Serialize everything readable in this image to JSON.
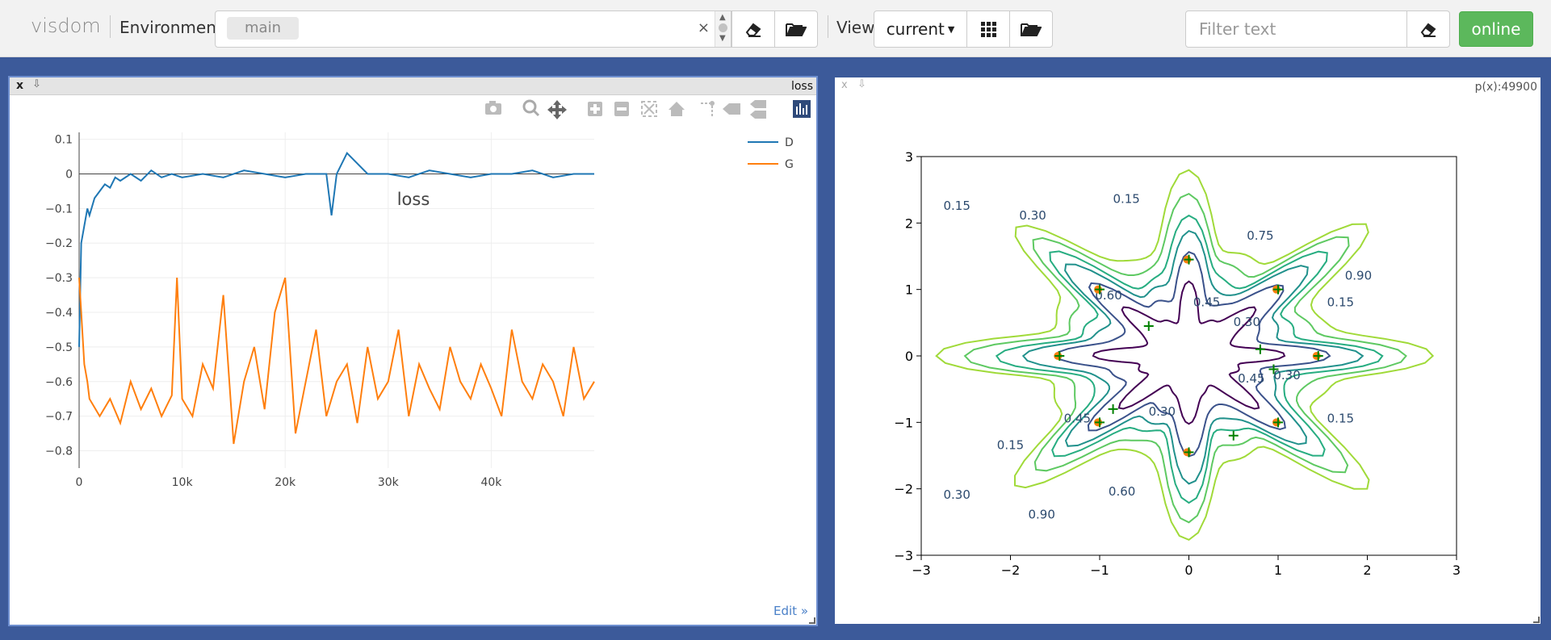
{
  "topbar": {
    "logo": "visdom",
    "environment_label": "Environment",
    "env_chip": "main",
    "env_clear": "×",
    "view_label": "View",
    "view_value": "current",
    "filter_placeholder": "Filter text",
    "status_button": "online"
  },
  "pane_loss": {
    "close": "x",
    "pin": "⇩",
    "header_title": "loss",
    "edit_link": "Edit »"
  },
  "pane_contour": {
    "close": "x",
    "pin": "⇩",
    "header_title": "p(x):49900"
  },
  "chart_data": [
    {
      "type": "line",
      "title": "loss",
      "xlabel": "",
      "ylabel": "",
      "xlim": [
        0,
        50000
      ],
      "ylim": [
        -0.85,
        0.12
      ],
      "x_ticks": [
        "0",
        "10k",
        "20k",
        "30k",
        "40k"
      ],
      "y_ticks": [
        "0.1",
        "0",
        "−0.1",
        "−0.2",
        "−0.3",
        "−0.4",
        "−0.5",
        "−0.6",
        "−0.7",
        "−0.8"
      ],
      "legend": "top-right",
      "grid": true,
      "series": [
        {
          "name": "D",
          "color": "#1f77b4",
          "x": [
            0,
            200,
            500,
            800,
            1000,
            1500,
            2000,
            2500,
            3000,
            3500,
            4000,
            5000,
            6000,
            7000,
            8000,
            9000,
            10000,
            12000,
            14000,
            16000,
            18000,
            20000,
            22000,
            24000,
            24500,
            25000,
            26000,
            28000,
            30000,
            32000,
            34000,
            36000,
            38000,
            40000,
            42000,
            44000,
            46000,
            48000,
            50000
          ],
          "y": [
            -0.5,
            -0.2,
            -0.15,
            -0.1,
            -0.12,
            -0.07,
            -0.05,
            -0.03,
            -0.04,
            -0.01,
            -0.02,
            0.0,
            -0.02,
            0.01,
            -0.01,
            0.0,
            -0.01,
            0.0,
            -0.01,
            0.01,
            0.0,
            -0.01,
            0.0,
            0.0,
            -0.12,
            0.0,
            0.06,
            0.0,
            0.0,
            -0.01,
            0.01,
            0.0,
            -0.01,
            0.0,
            0.0,
            0.01,
            -0.01,
            0.0,
            0.0
          ]
        },
        {
          "name": "G",
          "color": "#ff7f0e",
          "x": [
            0,
            200,
            500,
            800,
            1000,
            2000,
            3000,
            4000,
            5000,
            6000,
            7000,
            8000,
            9000,
            9500,
            10000,
            11000,
            12000,
            13000,
            14000,
            15000,
            16000,
            17000,
            18000,
            19000,
            20000,
            21000,
            22000,
            23000,
            24000,
            25000,
            26000,
            27000,
            28000,
            29000,
            30000,
            31000,
            32000,
            33000,
            34000,
            35000,
            36000,
            37000,
            38000,
            39000,
            40000,
            41000,
            42000,
            43000,
            44000,
            45000,
            46000,
            47000,
            48000,
            49000,
            50000
          ],
          "y": [
            -0.3,
            -0.4,
            -0.55,
            -0.6,
            -0.65,
            -0.7,
            -0.65,
            -0.72,
            -0.6,
            -0.68,
            -0.62,
            -0.7,
            -0.64,
            -0.3,
            -0.65,
            -0.7,
            -0.55,
            -0.62,
            -0.35,
            -0.78,
            -0.6,
            -0.5,
            -0.68,
            -0.4,
            -0.3,
            -0.75,
            -0.6,
            -0.45,
            -0.7,
            -0.6,
            -0.55,
            -0.72,
            -0.5,
            -0.65,
            -0.6,
            -0.45,
            -0.7,
            -0.55,
            -0.62,
            -0.68,
            -0.5,
            -0.6,
            -0.65,
            -0.55,
            -0.62,
            -0.7,
            -0.45,
            -0.6,
            -0.65,
            -0.55,
            -0.6,
            -0.7,
            -0.5,
            -0.65,
            -0.6
          ]
        }
      ]
    },
    {
      "type": "contour",
      "xlim": [
        -3,
        3
      ],
      "ylim": [
        -3,
        3
      ],
      "x_ticks": [
        "−3",
        "−2",
        "−1",
        "0",
        "1",
        "2",
        "3"
      ],
      "y_ticks": [
        "3",
        "2",
        "1",
        "0",
        "−1",
        "−2",
        "−3"
      ],
      "contour_labels": [
        "0.15",
        "0.30",
        "0.15",
        "0.60",
        "0.45",
        "0.30",
        "0.15",
        "0.75",
        "0.90",
        "0.45",
        "0.30",
        "0.15",
        "0.45",
        "0.30",
        "0.15",
        "0.30",
        "0.60",
        "0.90"
      ],
      "data_points": {
        "x": [
          -1.45,
          -1.0,
          0.0,
          1.0,
          1.45,
          1.0,
          0.0,
          -1.0,
          -0.45,
          0.8,
          0.95,
          0.5,
          -0.85
        ],
        "y": [
          0.0,
          1.0,
          1.45,
          1.0,
          0.0,
          -1.0,
          -1.45,
          -1.0,
          0.45,
          0.1,
          -0.2,
          -1.2,
          -0.8
        ]
      }
    }
  ]
}
